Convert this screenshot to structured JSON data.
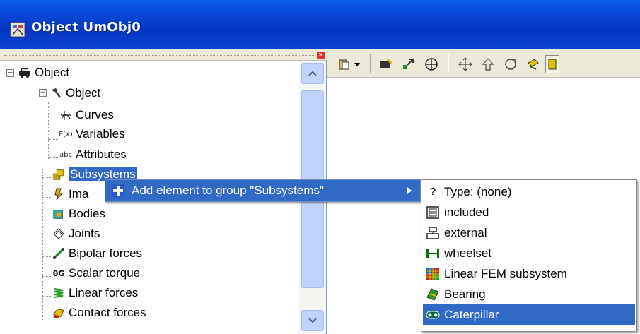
{
  "window": {
    "title": "Object UmObj0",
    "icon": "sims-app-icon"
  },
  "tree": {
    "root": {
      "label": "Object",
      "icon": "car-icon",
      "expander": "−"
    },
    "object_node": {
      "label": "Object",
      "icon": "hammer-icon",
      "expander": "−"
    },
    "children": [
      {
        "label": "Curves",
        "icon": "curves-icon"
      },
      {
        "label": "Variables",
        "icon": "variables-icon"
      },
      {
        "label": "Attributes",
        "icon": "attributes-icon"
      }
    ],
    "groups": [
      {
        "label": "Subsystems",
        "icon": "subsystems-icon",
        "selected": true
      },
      {
        "label": "Ima",
        "icon": "images-icon"
      },
      {
        "label": "Bodies",
        "icon": "bodies-icon"
      },
      {
        "label": "Joints",
        "icon": "joints-icon"
      },
      {
        "label": "Bipolar forces",
        "icon": "bipolar-forces-icon"
      },
      {
        "label": "Scalar torque",
        "icon": "scalar-torque-icon"
      },
      {
        "label": "Linear forces",
        "icon": "linear-forces-icon"
      },
      {
        "label": "Contact forces",
        "icon": "contact-forces-icon"
      }
    ]
  },
  "context_menu": {
    "item": {
      "label": "Add element to group \"Subsystems\"",
      "icon": "plus-icon",
      "has_submenu": true
    }
  },
  "submenu": {
    "items": [
      {
        "label": "Type: (none)",
        "icon": "question-icon",
        "highlighted": false
      },
      {
        "label": "included",
        "icon": "included-icon",
        "highlighted": false
      },
      {
        "label": "external",
        "icon": "external-icon",
        "highlighted": false
      },
      {
        "label": "wheelset",
        "icon": "wheelset-icon",
        "highlighted": false
      },
      {
        "label": "Linear FEM subsystem",
        "icon": "fem-icon",
        "highlighted": false
      },
      {
        "label": "Bearing",
        "icon": "bearing-icon",
        "highlighted": false
      },
      {
        "label": "Caterpillar",
        "icon": "caterpillar-icon",
        "highlighted": true
      }
    ]
  },
  "toolbar": {
    "buttons": [
      "paste-icon",
      "dropdown-icon",
      "edit-icon",
      "resize-icon",
      "target-icon",
      "move-icon",
      "up-arrow-icon",
      "rotate-icon",
      "swap-icon",
      "partial-icon"
    ]
  },
  "colors": {
    "title_bar": "#0847d4",
    "selection": "#316ac5",
    "chrome": "#ece9d8"
  }
}
